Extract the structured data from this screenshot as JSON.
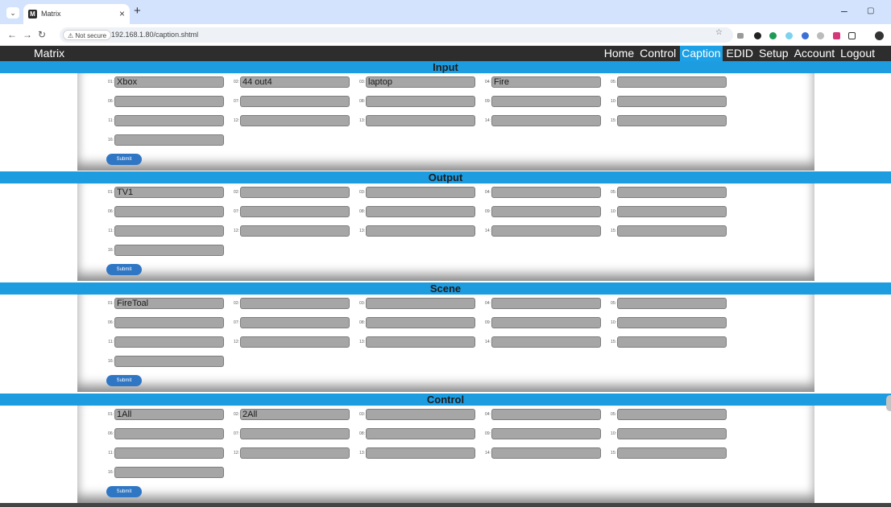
{
  "browser": {
    "tab_list_icon": "chevron-down-icon",
    "tab_favicon": "M",
    "tab_title": "Matrix",
    "tab_close": "×",
    "new_tab": "+",
    "security_label": "⚠ Not secure",
    "url": "192.168.1.80/caption.shtml",
    "minimize": "–",
    "restore": "▢"
  },
  "app": {
    "brand": "Matrix",
    "menu": [
      {
        "label": "Home"
      },
      {
        "label": "Control"
      },
      {
        "label": "Caption"
      },
      {
        "label": "EDID"
      },
      {
        "label": "Setup"
      },
      {
        "label": "Account"
      },
      {
        "label": "Logout"
      }
    ],
    "active_menu": "Caption",
    "accent_color": "#1e9ce0"
  },
  "sections": [
    {
      "title": "Input",
      "submit_label": "Submit",
      "fields": [
        {
          "num": "01",
          "value": "Xbox"
        },
        {
          "num": "02",
          "value": "44 out4"
        },
        {
          "num": "03",
          "value": "laptop"
        },
        {
          "num": "04",
          "value": "Fire"
        },
        {
          "num": "05",
          "value": ""
        },
        {
          "num": "06",
          "value": ""
        },
        {
          "num": "07",
          "value": ""
        },
        {
          "num": "08",
          "value": ""
        },
        {
          "num": "09",
          "value": ""
        },
        {
          "num": "10",
          "value": ""
        },
        {
          "num": "11",
          "value": ""
        },
        {
          "num": "12",
          "value": ""
        },
        {
          "num": "13",
          "value": ""
        },
        {
          "num": "14",
          "value": ""
        },
        {
          "num": "15",
          "value": ""
        },
        {
          "num": "16",
          "value": ""
        }
      ]
    },
    {
      "title": "Output",
      "submit_label": "Submit",
      "fields": [
        {
          "num": "01",
          "value": "TV1"
        },
        {
          "num": "02",
          "value": ""
        },
        {
          "num": "03",
          "value": ""
        },
        {
          "num": "04",
          "value": ""
        },
        {
          "num": "05",
          "value": ""
        },
        {
          "num": "06",
          "value": ""
        },
        {
          "num": "07",
          "value": ""
        },
        {
          "num": "08",
          "value": ""
        },
        {
          "num": "09",
          "value": ""
        },
        {
          "num": "10",
          "value": ""
        },
        {
          "num": "11",
          "value": ""
        },
        {
          "num": "12",
          "value": ""
        },
        {
          "num": "13",
          "value": ""
        },
        {
          "num": "14",
          "value": ""
        },
        {
          "num": "15",
          "value": ""
        },
        {
          "num": "16",
          "value": ""
        }
      ]
    },
    {
      "title": "Scene",
      "submit_label": "Submit",
      "fields": [
        {
          "num": "01",
          "value": "FireToal"
        },
        {
          "num": "02",
          "value": ""
        },
        {
          "num": "03",
          "value": ""
        },
        {
          "num": "04",
          "value": ""
        },
        {
          "num": "05",
          "value": ""
        },
        {
          "num": "06",
          "value": ""
        },
        {
          "num": "07",
          "value": ""
        },
        {
          "num": "08",
          "value": ""
        },
        {
          "num": "09",
          "value": ""
        },
        {
          "num": "10",
          "value": ""
        },
        {
          "num": "11",
          "value": ""
        },
        {
          "num": "12",
          "value": ""
        },
        {
          "num": "13",
          "value": ""
        },
        {
          "num": "14",
          "value": ""
        },
        {
          "num": "15",
          "value": ""
        },
        {
          "num": "16",
          "value": ""
        }
      ]
    },
    {
      "title": "Control",
      "submit_label": "Submit",
      "fields": [
        {
          "num": "01",
          "value": "1All"
        },
        {
          "num": "02",
          "value": "2All"
        },
        {
          "num": "03",
          "value": ""
        },
        {
          "num": "04",
          "value": ""
        },
        {
          "num": "05",
          "value": ""
        },
        {
          "num": "06",
          "value": ""
        },
        {
          "num": "07",
          "value": ""
        },
        {
          "num": "08",
          "value": ""
        },
        {
          "num": "09",
          "value": ""
        },
        {
          "num": "10",
          "value": ""
        },
        {
          "num": "11",
          "value": ""
        },
        {
          "num": "12",
          "value": ""
        },
        {
          "num": "13",
          "value": ""
        },
        {
          "num": "14",
          "value": ""
        },
        {
          "num": "15",
          "value": ""
        },
        {
          "num": "16",
          "value": ""
        }
      ]
    }
  ]
}
